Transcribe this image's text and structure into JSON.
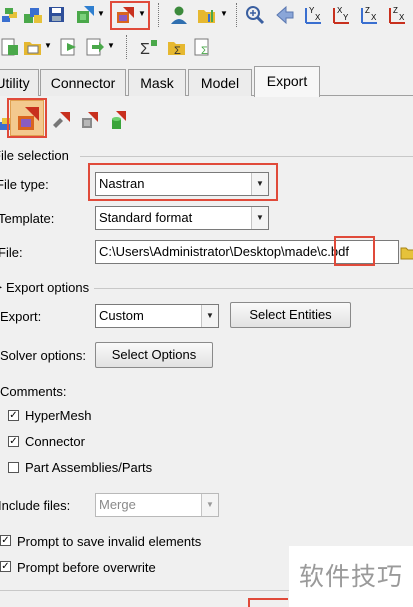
{
  "tabs": [
    {
      "label": "Utility"
    },
    {
      "label": "Connector"
    },
    {
      "label": "Mask"
    },
    {
      "label": "Model"
    },
    {
      "label": "Export"
    }
  ],
  "file_selection": {
    "heading": "File selection",
    "file_type_label": "File type:",
    "file_type_value": "Nastran",
    "template_label": "Template:",
    "template_value": "Standard format",
    "file_label": "File:",
    "file_path": "C:\\Users\\Administrator\\Desktop\\made\\c.bdf"
  },
  "export_options": {
    "heading": "Export options",
    "export_label": "Export:",
    "export_value": "Custom",
    "select_entities_label": "Select Entities",
    "solver_options_label": "Solver options:",
    "select_options_label": "Select Options",
    "comments_label": "Comments:",
    "comments": [
      {
        "label": "HyperMesh",
        "checked": true
      },
      {
        "label": "Connector",
        "checked": true
      },
      {
        "label": "Part Assemblies/Parts",
        "checked": false
      }
    ],
    "include_files_label": "Include files:",
    "include_files_value": "Merge",
    "prompt_invalid_label": "Prompt to save invalid elements",
    "prompt_invalid_checked": true,
    "prompt_overwrite_label": "Prompt before overwrite",
    "prompt_overwrite_checked": true
  },
  "watermark": "软件技巧",
  "colors": {
    "highlight": "#e04a3a",
    "panel_bg": "#f0f0f0",
    "icon_orange": "#d9651e",
    "icon_red": "#c8301e"
  }
}
